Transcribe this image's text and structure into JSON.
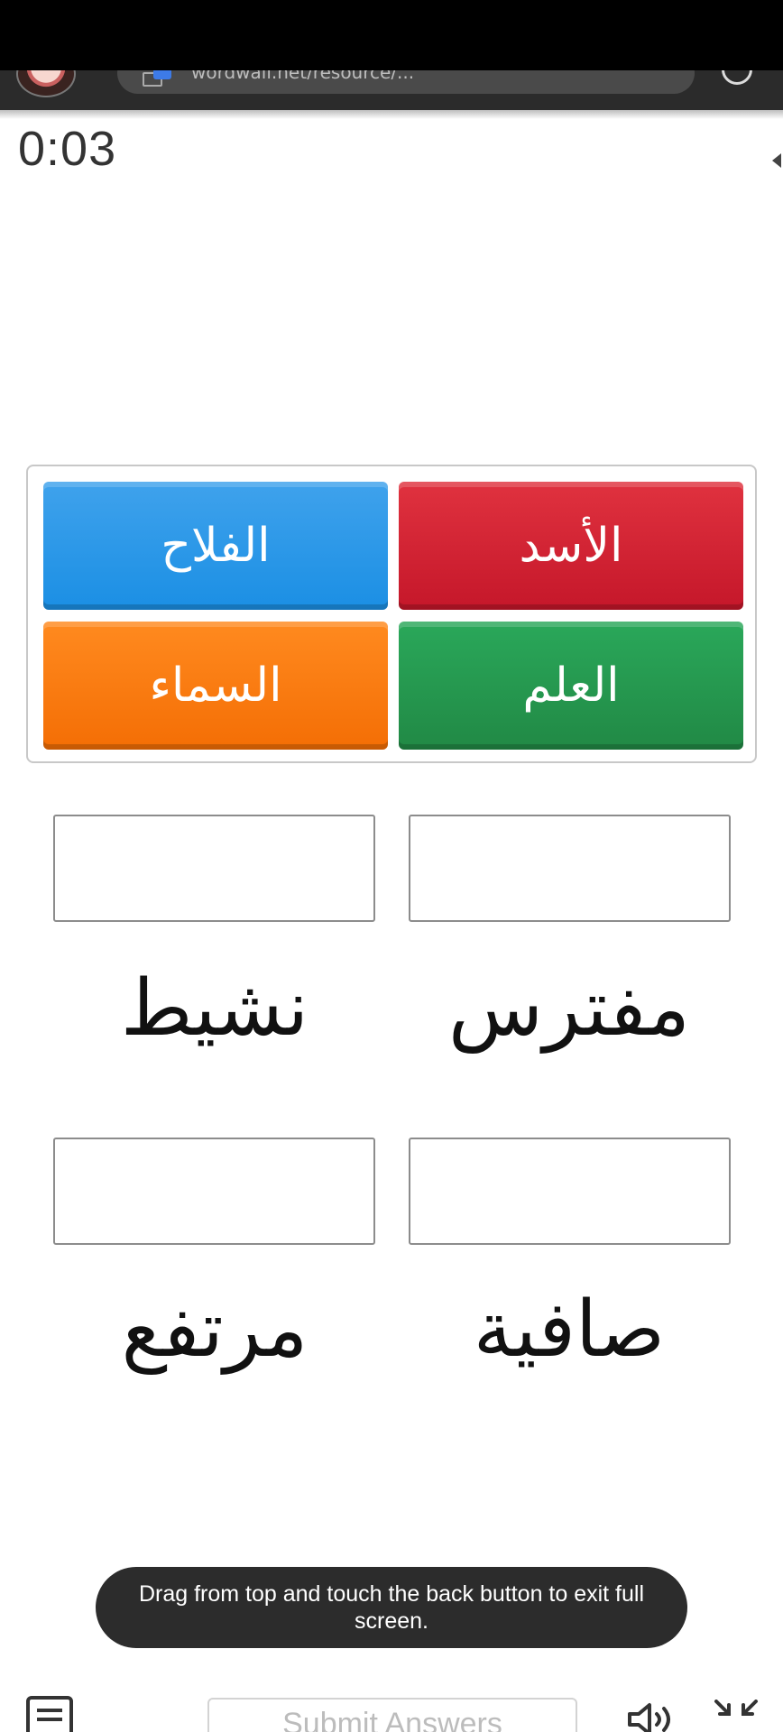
{
  "browser": {
    "url_text": "wordwall.net/resource/...",
    "avatar_icon": "user-avatar",
    "site_icon": "tab-icon",
    "refresh_icon": "refresh-icon"
  },
  "game": {
    "timer": "0:03",
    "options": [
      {
        "label": "الفلاح",
        "color": "#1b8fe4"
      },
      {
        "label": "الأسد",
        "color": "#c5172a"
      },
      {
        "label": "السماء",
        "color": "#f46e05"
      },
      {
        "label": "العلم",
        "color": "#218945"
      }
    ],
    "prompts": [
      {
        "word": "نشيط",
        "answer": ""
      },
      {
        "word": "مفترس",
        "answer": ""
      },
      {
        "word": "مرتفع",
        "answer": ""
      },
      {
        "word": "صافية",
        "answer": ""
      }
    ]
  },
  "toast": {
    "message": "Drag from top and touch the back button to exit full screen."
  },
  "footer": {
    "menu_icon": "menu-icon",
    "submit_label": "Submit Answers",
    "sound_icon": "speaker-icon",
    "exit_fullscreen_icon": "exit-fullscreen-icon"
  }
}
